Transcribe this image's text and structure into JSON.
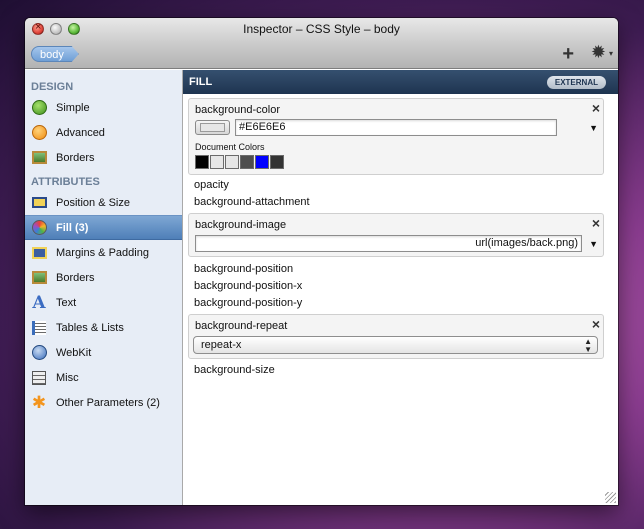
{
  "window": {
    "title": "Inspector – CSS Style – body",
    "breadcrumb": "body",
    "add_icon": "plus-icon",
    "gear_icon": "gear-icon"
  },
  "sidebar": {
    "design_header": "DESIGN",
    "design_items": [
      {
        "label": "Simple",
        "icon": "green-ball-icon"
      },
      {
        "label": "Advanced",
        "icon": "orange-ball-icon"
      },
      {
        "label": "Borders",
        "icon": "picture-frame-icon"
      }
    ],
    "attributes_header": "ATTRIBUTES",
    "attribute_items": [
      {
        "label": "Position & Size",
        "icon": "box-icon"
      },
      {
        "label": "Fill (3)",
        "icon": "color-wheel-icon",
        "selected": true
      },
      {
        "label": "Margins & Padding",
        "icon": "margins-icon"
      },
      {
        "label": "Borders",
        "icon": "picture-frame-icon"
      },
      {
        "label": "Text",
        "icon": "letter-a-icon"
      },
      {
        "label": "Tables & Lists",
        "icon": "list-icon"
      },
      {
        "label": "WebKit",
        "icon": "compass-icon"
      },
      {
        "label": "Misc",
        "icon": "sliders-icon"
      },
      {
        "label": "Other Parameters (2)",
        "icon": "asterisk-icon"
      }
    ]
  },
  "main": {
    "section_title": "FILL",
    "badge": "EXTERNAL",
    "bg_color": {
      "label": "background-color",
      "value": "#E6E6E6",
      "swatch_color": "#E6E6E6",
      "doc_colors_label": "Document Colors",
      "doc_colors": [
        "#000000",
        "#E6E6E6",
        "#E6E6E6",
        "#4D4D4D",
        "#0000FF",
        "#333333"
      ]
    },
    "opacity_label": "opacity",
    "attachment_label": "background-attachment",
    "bg_image": {
      "label": "background-image",
      "value": "url(images/back.png)"
    },
    "position_label": "background-position",
    "position_x_label": "background-position-x",
    "position_y_label": "background-position-y",
    "bg_repeat": {
      "label": "background-repeat",
      "value": "repeat-x"
    },
    "size_label": "background-size",
    "close_symbol": "×"
  }
}
